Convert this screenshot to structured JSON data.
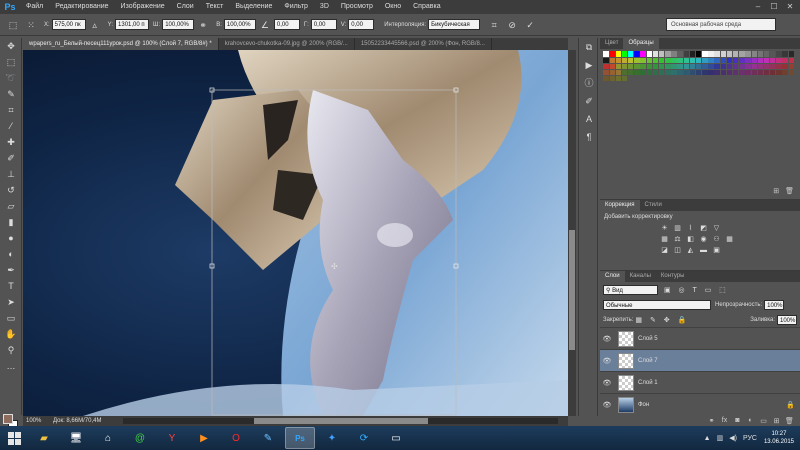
{
  "app": {
    "logo": "Ps"
  },
  "menu": [
    "Файл",
    "Редактирование",
    "Изображение",
    "Слои",
    "Текст",
    "Выделение",
    "Фильтр",
    "3D",
    "Просмотр",
    "Окно",
    "Справка"
  ],
  "options": {
    "x_label": "X:",
    "x_value": "575,00 пк",
    "y_label": "Y:",
    "y_value": "1301,00 п",
    "w_label": "Ш:",
    "w_value": "100,00%",
    "h_label": "В:",
    "h_value": "100,00%",
    "angle_value": "0,00",
    "hskew_label": "Г:",
    "hskew_value": "0,00",
    "vskew_label": "V:",
    "vskew_value": "0,00",
    "interp_label": "Интерполяция:",
    "interp_value": "Бикубическая",
    "workspace": "Основная рабочая среда"
  },
  "doc_tabs": [
    "wpapers_ru_Белый-песец111урок.psd @ 100% (Слой 7, RGB/8#) *",
    "krahovcevo-chukotka-09.jpg @ 200% (RGB/...",
    "15052233445566.psd @ 200% (Фон, RGB/8..."
  ],
  "status": {
    "zoom": "100%",
    "doc": "Док: 8,66M/70,4M"
  },
  "swatches_panel": {
    "tabs": [
      "Цвет",
      "Образцы"
    ]
  },
  "adjust_panel": {
    "tabs": [
      "Коррекция",
      "Стили"
    ],
    "title": "Добавить корректировку"
  },
  "layers_panel": {
    "tabs": [
      "Слои",
      "Каналы",
      "Контуры"
    ],
    "filter_label": "Вид",
    "blend_mode": "Обычные",
    "opacity_label": "Непрозрачность:",
    "opacity_value": "100%",
    "lock_label": "Закрепить:",
    "fill_label": "Заливка:",
    "fill_value": "100%",
    "layers": [
      {
        "name": "Слой 5"
      },
      {
        "name": "Слой 7"
      },
      {
        "name": "Слой 1"
      },
      {
        "name": "Фон"
      }
    ]
  },
  "taskbar": {
    "lang": "РУС",
    "time": "10:27",
    "date": "13.06.2015"
  }
}
